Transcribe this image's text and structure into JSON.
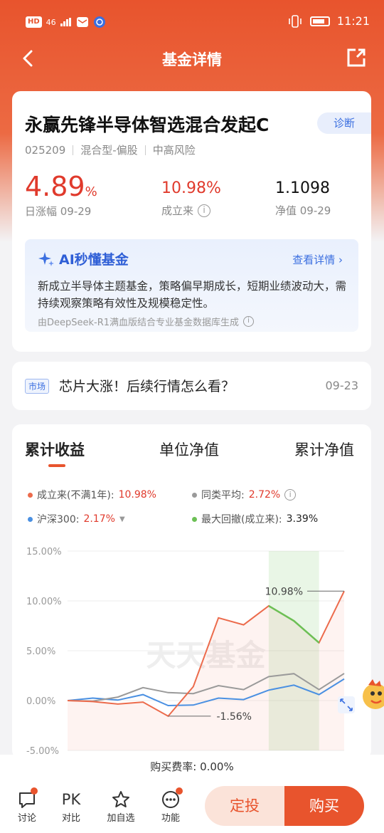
{
  "statusbar": {
    "badge": "HD",
    "network": "46",
    "time": "11:21"
  },
  "nav": {
    "title": "基金详情"
  },
  "fund": {
    "name": "永赢先锋半导体智选混合发起C",
    "diagnose_label": "诊断",
    "code": "025209",
    "type": "混合型-偏股",
    "risk": "中高风险",
    "day_change_value": "4.89",
    "day_change_unit": "%",
    "day_change_label": "日涨幅 09-29",
    "since_inception_value": "10.98%",
    "since_inception_label": "成立来",
    "nav_value": "1.1098",
    "nav_label": "净值 09-29"
  },
  "ai": {
    "title": "AI秒懂基金",
    "link": "查看详情",
    "text": "新成立半导体主题基金，策略偏早期成长，短期业绩波动大，需持续观察策略有效性及规模稳定性。",
    "footer": "由DeepSeek-R1满血版结合专业基金数据库生成"
  },
  "news": {
    "tag": "市场",
    "text": "芯片大涨！后续行情怎么看？",
    "date": "09-23"
  },
  "tabs": {
    "t1": "累计收益",
    "t2": "单位净值",
    "t3": "累计净值"
  },
  "legend": {
    "l1_label": "成立来(不满1年):",
    "l1_value": "10.98%",
    "l2_label": "同类平均:",
    "l2_value": "2.72%",
    "l3_label": "沪深300:",
    "l3_value": "2.17%",
    "l4_label": "最大回撤(成立来):",
    "l4_value": "3.39%"
  },
  "colors": {
    "accent": "#e8542d",
    "fund": "#ec6b4c",
    "peer": "#9a9a9a",
    "hs300": "#4a90e2",
    "drawdown": "#6cc055"
  },
  "chart_data": {
    "type": "line",
    "ylim": [
      -5,
      15
    ],
    "yticks": [
      "15.00%",
      "10.00%",
      "5.00%",
      "0.00%",
      "-5.00%"
    ],
    "watermark": "天天基金",
    "series": [
      {
        "name": "成立来",
        "values": [
          0,
          -0.1,
          -0.35,
          -0.15,
          -1.56,
          1.4,
          8.3,
          7.6,
          9.5,
          8.0,
          5.8,
          10.98
        ]
      },
      {
        "name": "同类平均",
        "values": [
          0,
          -0.05,
          0.35,
          1.3,
          0.8,
          0.7,
          1.5,
          1.1,
          2.4,
          2.7,
          1.1,
          2.72
        ]
      },
      {
        "name": "沪深300",
        "values": [
          0,
          0.25,
          0.05,
          0.6,
          -0.5,
          -0.45,
          0.25,
          0.1,
          1.05,
          1.55,
          0.6,
          2.17
        ]
      }
    ],
    "annotations": {
      "max": "10.98%",
      "min": "-1.56%"
    },
    "drawdown_range": [
      8,
      10
    ]
  },
  "footer": {
    "fee": "购买费率: 0.00%",
    "discuss": "讨论",
    "pk_icon": "PK",
    "compare": "对比",
    "watchlist": "加自选",
    "functions": "功能",
    "sip": "定投",
    "buy": "购买"
  }
}
